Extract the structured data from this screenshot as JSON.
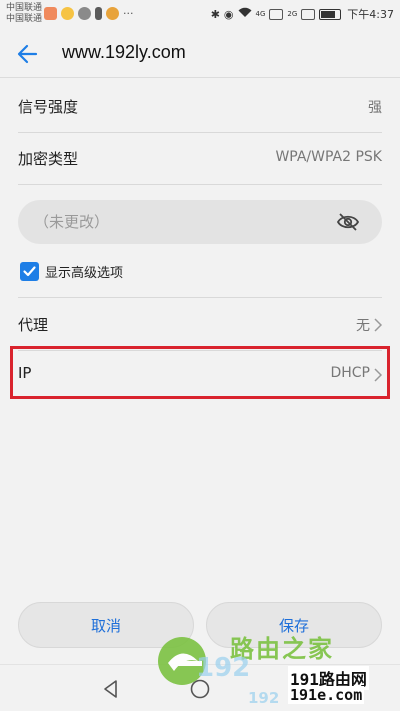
{
  "status_bar": {
    "carrier_1": "中国联通",
    "carrier_2": "中国联通",
    "network_1": "4G",
    "network_2": "2G",
    "time": "下午4:37"
  },
  "toolbar": {
    "back_icon": "arrow-left-icon",
    "title": "www.192ly.com"
  },
  "signal": {
    "label": "信号强度",
    "value": "强"
  },
  "encryption": {
    "label": "加密类型",
    "value": "WPA/WPA2 PSK"
  },
  "password": {
    "placeholder": "（未更改）",
    "eye_icon": "eye-off-icon"
  },
  "advanced": {
    "label": "显示高级选项",
    "checked": true
  },
  "proxy": {
    "label": "代理",
    "value": "无"
  },
  "ip": {
    "label": "IP",
    "value": "DHCP"
  },
  "buttons": {
    "cancel": "取消",
    "save": "保存"
  },
  "nav_bar": {
    "icons": [
      "back-triangle-icon",
      "home-circle-icon"
    ]
  },
  "watermark": {
    "brand": "路由之家",
    "ip_text": "192",
    "ip_text_small": "192",
    "number": "191路由网",
    "url": "191e.com"
  },
  "colors": {
    "accent": "#1e7ee6",
    "highlight_border": "#d9232d",
    "background": "#f2f2f2"
  }
}
